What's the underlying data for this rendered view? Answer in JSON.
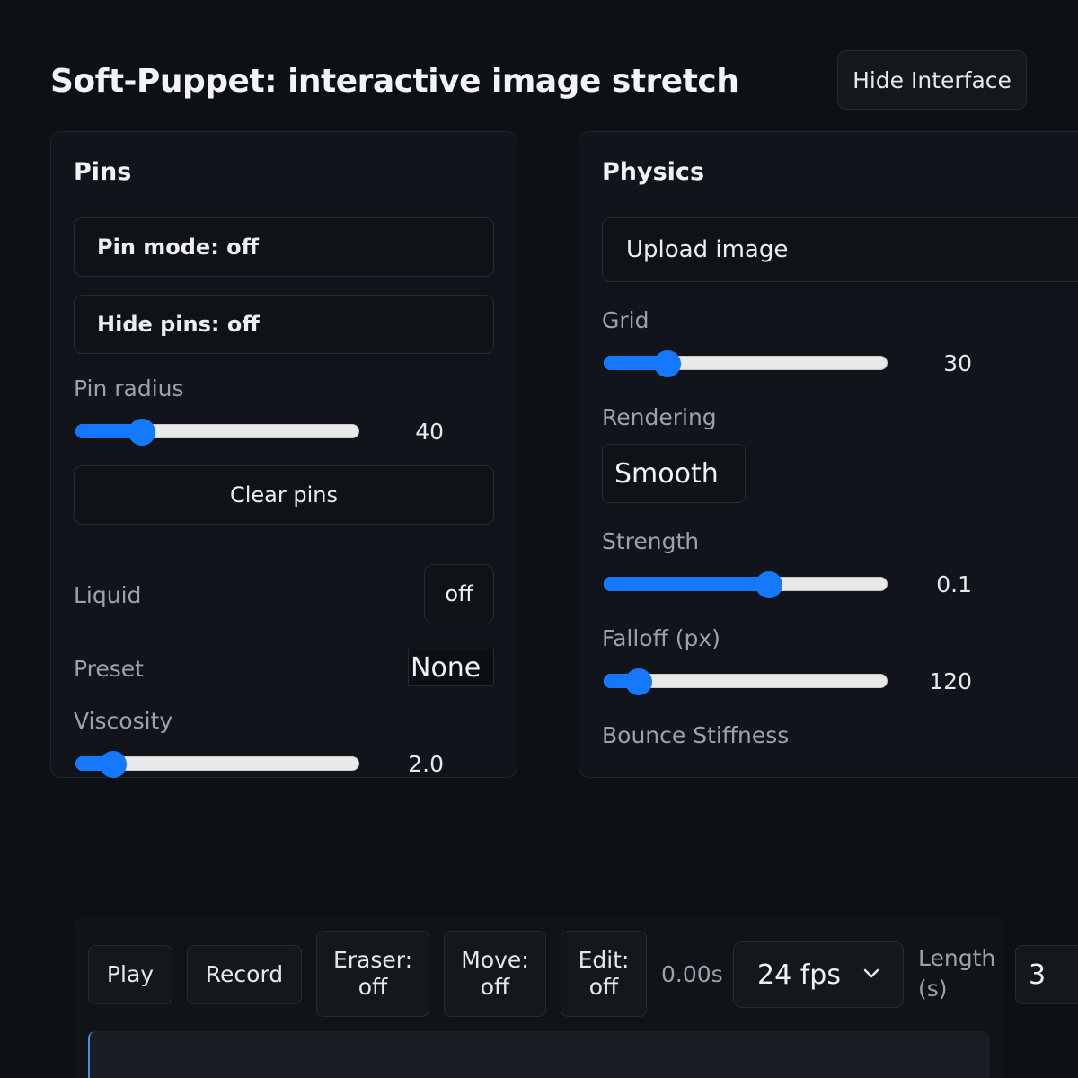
{
  "header": {
    "title": "Soft-Puppet: interactive image stretch",
    "hide_interface_label": "Hide Interface"
  },
  "pins_panel": {
    "heading": "Pins",
    "pin_mode_label": "Pin mode: off",
    "hide_pins_label": "Hide pins: off",
    "pin_radius": {
      "label": "Pin radius",
      "value": "40",
      "fraction": 0.23
    },
    "clear_pins_label": "Clear pins",
    "liquid": {
      "label": "Liquid",
      "toggle": "off"
    },
    "preset": {
      "label": "Preset",
      "value": "None"
    },
    "viscosity": {
      "label": "Viscosity",
      "value": "2.0",
      "fraction": 0.13
    }
  },
  "physics_panel": {
    "heading": "Physics",
    "upload_label": "Upload image",
    "grid": {
      "label": "Grid",
      "value": "30",
      "fraction": 0.22
    },
    "rendering": {
      "label": "Rendering",
      "value": "Smooth"
    },
    "strength": {
      "label": "Strength",
      "value": "0.1",
      "fraction": 0.58
    },
    "falloff": {
      "label": "Falloff (px)",
      "value": "120",
      "fraction": 0.12
    },
    "bounce_label": "Bounce Stiffness"
  },
  "timeline": {
    "play_label": "Play",
    "record_label": "Record",
    "eraser": {
      "line1": "Eraser:",
      "line2": "off"
    },
    "move": {
      "line1": "Move:",
      "line2": "off"
    },
    "edit": {
      "line1": "Edit:",
      "line2": "off"
    },
    "time": "0.00s",
    "fps_value": "24 fps",
    "length_label_line1": "Length",
    "length_label_line2": "(s)",
    "length_value": "3"
  },
  "colors": {
    "accent": "#1479ff",
    "background": "#0d1014",
    "panel": "#11141a"
  },
  "icons": {
    "fps_dropdown": "chevron-down-icon"
  }
}
